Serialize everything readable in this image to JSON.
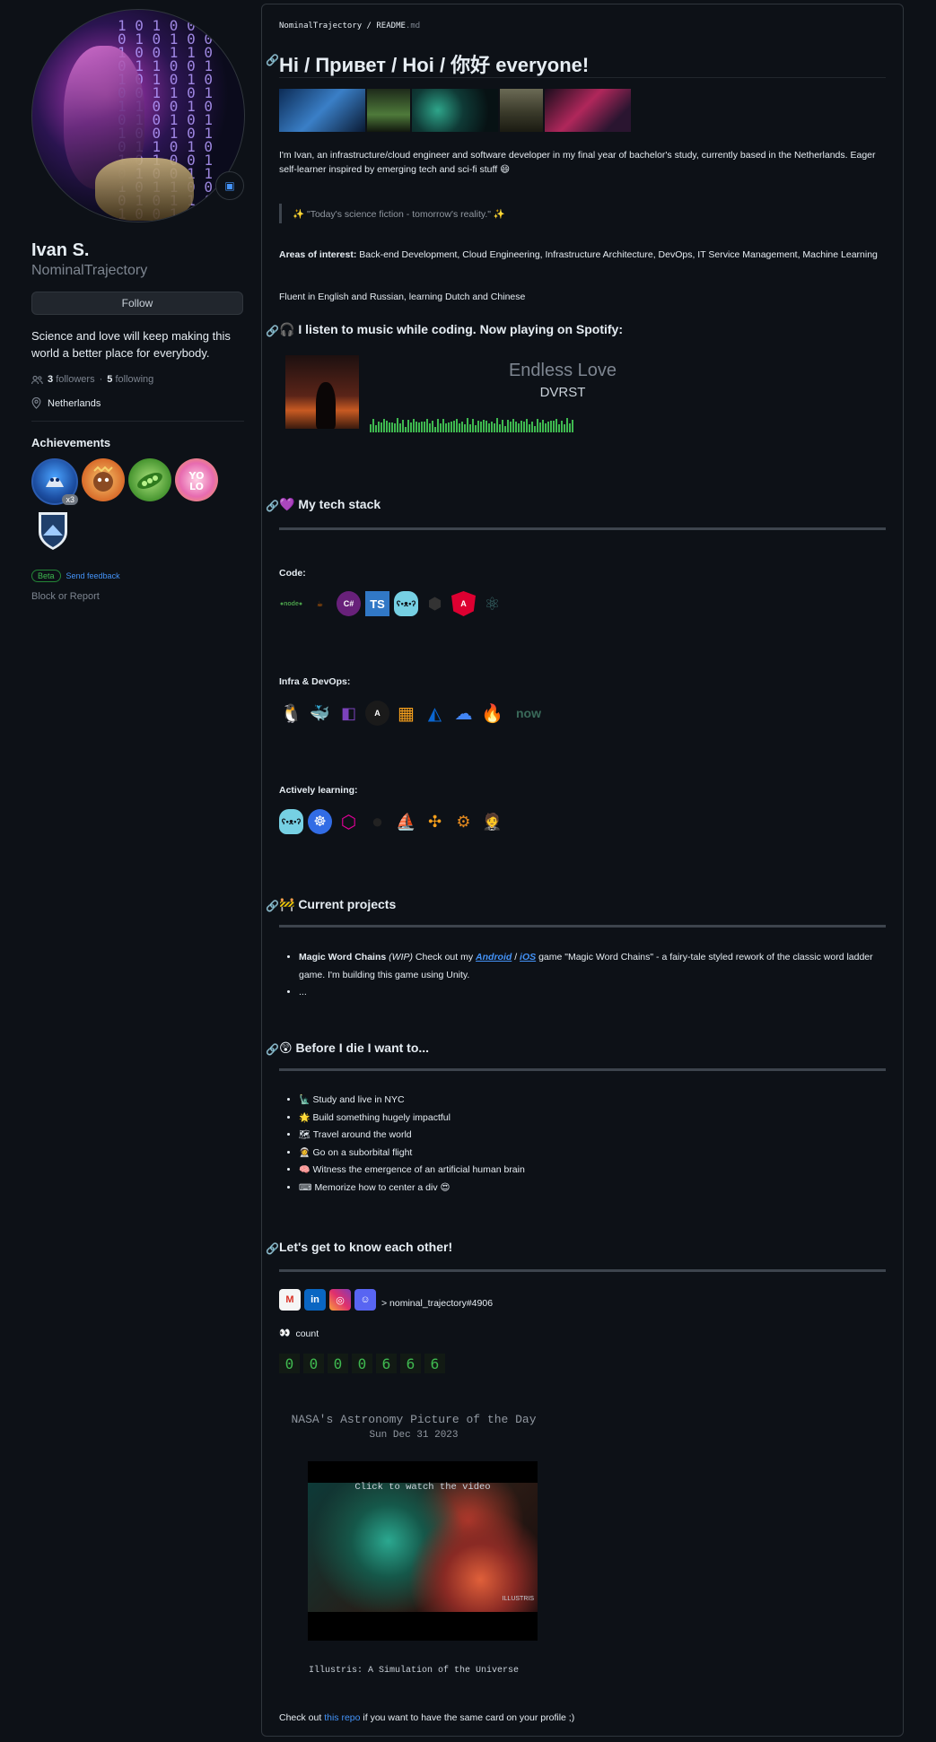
{
  "profile": {
    "name": "Ivan S.",
    "login": "NominalTrajectory",
    "follow_label": "Follow",
    "bio": "Science and love will keep making this world a better place for everybody.",
    "followers_count": "3",
    "followers_label": "followers",
    "separator": "·",
    "following_count": "5",
    "following_label": "following",
    "location": "Netherlands",
    "achievements_title": "Achievements",
    "achievement_multiplier": "x3",
    "beta_label": "Beta",
    "feedback_label": "Send feedback",
    "block_label": "Block or Report"
  },
  "readme": {
    "crumb_user": "NominalTrajectory",
    "crumb_sep": "/",
    "crumb_file": "README",
    "crumb_ext": ".md",
    "title": "Hi / Привет / Hoi / 你好 everyone!",
    "intro": "I'm Ivan, an infrastructure/cloud engineer and software developer in my final year of bachelor's study, currently based in the Netherlands. Eager self-learner inspired by emerging tech and sci-fi stuff 😄",
    "quote": "✨ \"Today's science fiction - tomorrow's reality.\" ✨",
    "interests_label": "Areas of interest:",
    "interests": "Back-end Development, Cloud Engineering, Infrastructure Architecture, DevOps, IT Service Management, Machine Learning",
    "languages": "Fluent in English and Russian, learning Dutch and Chinese",
    "music_heading": "🎧 I listen to music while coding. Now playing on Spotify:",
    "song": "Endless Love",
    "artist": "DVRST",
    "stack_heading": "💜 My tech stack",
    "code_label": "Code:",
    "infra_label": "Infra & DevOps:",
    "learning_label": "Actively learning:",
    "projects_heading": "🚧 Current projects",
    "project_name": "Magic Word Chains",
    "project_wip": "(WIP)",
    "project_text1": "Check out my",
    "project_android": "Android",
    "project_slash": "/",
    "project_ios": "iOS",
    "project_text2": "game \"Magic Word Chains\" - a fairy-tale styled rework of the classic word ladder game. I'm building this game using Unity.",
    "project_more": "...",
    "bucket_heading": "😲 Before I die I want to...",
    "bucket": [
      {
        "emoji": "🗽",
        "text": "Study and live in NYC"
      },
      {
        "emoji": "🌟",
        "text": "Build something hugely impactful"
      },
      {
        "emoji": "🗺",
        "text": "Travel around the world"
      },
      {
        "emoji": "👩‍🚀",
        "text": "Go on a suborbital flight"
      },
      {
        "emoji": "🧠",
        "text": "Witness the emergence of an artificial human brain"
      },
      {
        "emoji": "⌨",
        "text": "Memorize how to center a div 😍"
      }
    ],
    "contact_heading": "Let's get to know each other!",
    "discord": "> nominal_trajectory#4906",
    "count_label": "count",
    "counter_digits": [
      "0",
      "0",
      "0",
      "0",
      "6",
      "6",
      "6"
    ],
    "apod_title": "NASA's Astronomy Picture of the Day",
    "apod_date": "Sun Dec 31 2023",
    "video_hint": "Click to watch the video",
    "video_brand": "ILLUSTRIS",
    "apod_caption": "Illustris: A Simulation of the Universe",
    "footer_pre": "Check out",
    "footer_link": "this repo",
    "footer_post": "if you want to have the same card on your profile ;)"
  }
}
